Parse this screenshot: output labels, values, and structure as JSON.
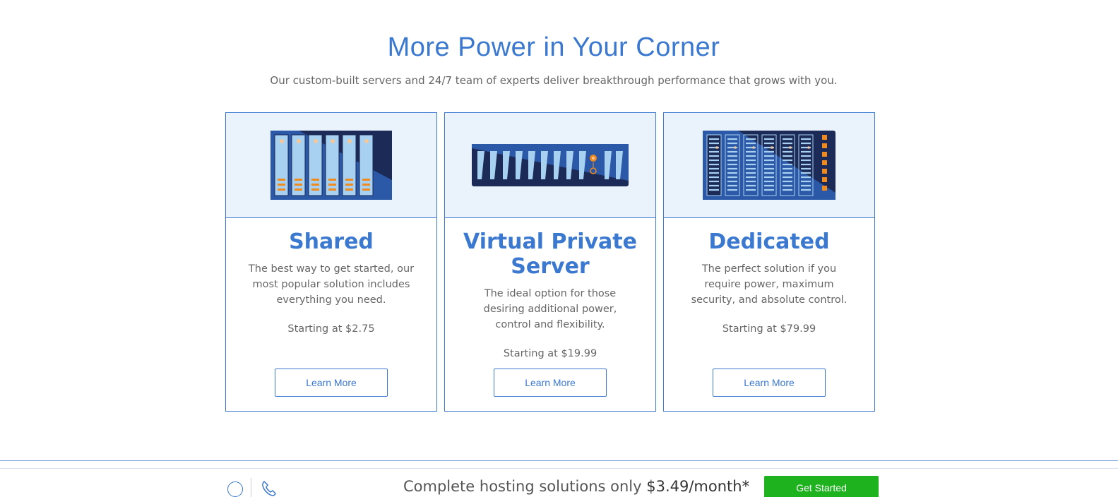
{
  "section": {
    "headline": "More Power in Your Corner",
    "subhead": "Our custom-built servers and 24/7 team of experts deliver breakthrough performance that grows with you."
  },
  "cards": [
    {
      "title": "Shared",
      "description": "The best way to get started, our most popular solution includes everything you need.",
      "price": "Starting at $2.75",
      "button": "Learn More",
      "icon": "shared-server-icon"
    },
    {
      "title": "Virtual Private Server",
      "description": "The ideal option for those desiring additional power, control and flexibility.",
      "price": "Starting at $19.99",
      "button": "Learn More",
      "icon": "vps-server-icon"
    },
    {
      "title": "Dedicated",
      "description": "The perfect solution if you require power, maximum security, and absolute control.",
      "price": "Starting at $79.99",
      "button": "Learn More",
      "icon": "dedicated-server-icon"
    }
  ],
  "footer": {
    "text": "Complete hosting solutions only ",
    "price": "$3.49/month*",
    "cta": "Get Started",
    "icons": [
      "chat-icon",
      "phone-icon"
    ]
  },
  "colors": {
    "brand_blue": "#3b78cf",
    "dark_navy": "#1b2a56",
    "light_blue": "#a8d0f0",
    "accent_orange": "#f08a1c",
    "cta_green": "#1fb21f",
    "card_header_bg": "#eaf2fb"
  }
}
